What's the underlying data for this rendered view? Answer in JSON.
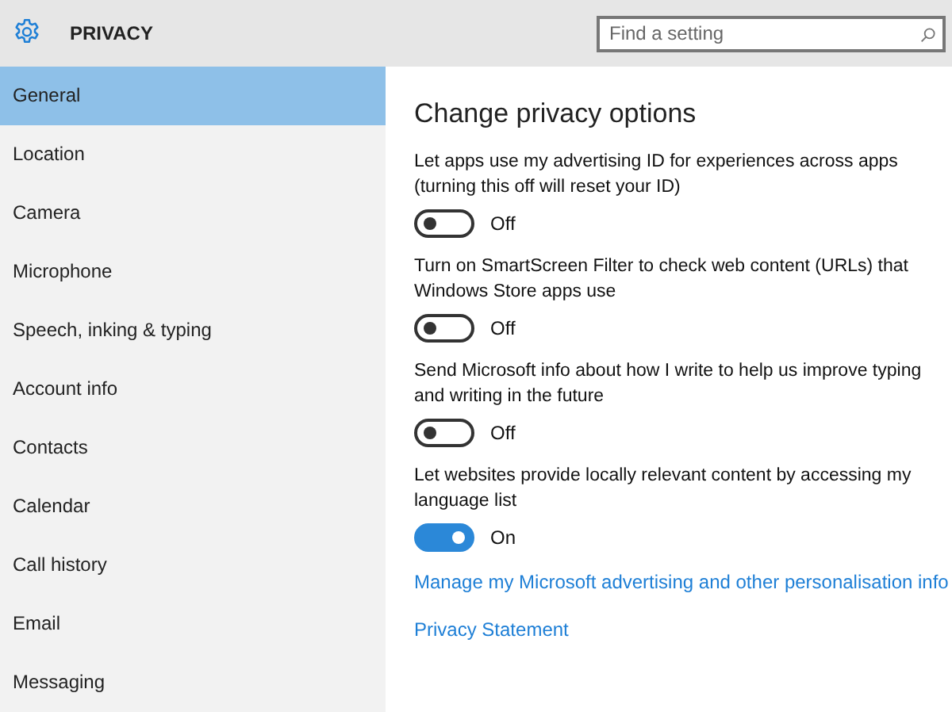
{
  "header": {
    "title": "PRIVACY",
    "search": {
      "placeholder": "Find a setting"
    }
  },
  "sidebar": {
    "items": [
      {
        "label": "General",
        "selected": true
      },
      {
        "label": "Location",
        "selected": false
      },
      {
        "label": "Camera",
        "selected": false
      },
      {
        "label": "Microphone",
        "selected": false
      },
      {
        "label": "Speech, inking & typing",
        "selected": false
      },
      {
        "label": "Account info",
        "selected": false
      },
      {
        "label": "Contacts",
        "selected": false
      },
      {
        "label": "Calendar",
        "selected": false
      },
      {
        "label": "Call history",
        "selected": false
      },
      {
        "label": "Email",
        "selected": false
      },
      {
        "label": "Messaging",
        "selected": false
      }
    ]
  },
  "content": {
    "title": "Change privacy options",
    "settings": [
      {
        "description": "Let apps use my advertising ID for experiences across apps (turning this off will reset your ID)",
        "on": false,
        "state_label": "Off"
      },
      {
        "description": "Turn on SmartScreen Filter to check web content (URLs) that Windows Store apps use",
        "on": false,
        "state_label": "Off"
      },
      {
        "description": "Send Microsoft info about how I write to help us improve typing and writing in the future",
        "on": false,
        "state_label": "Off"
      },
      {
        "description": "Let websites provide locally relevant content by accessing my language list",
        "on": true,
        "state_label": "On"
      }
    ],
    "links": [
      "Manage my Microsoft advertising and other personalisation info",
      "Privacy Statement"
    ]
  }
}
